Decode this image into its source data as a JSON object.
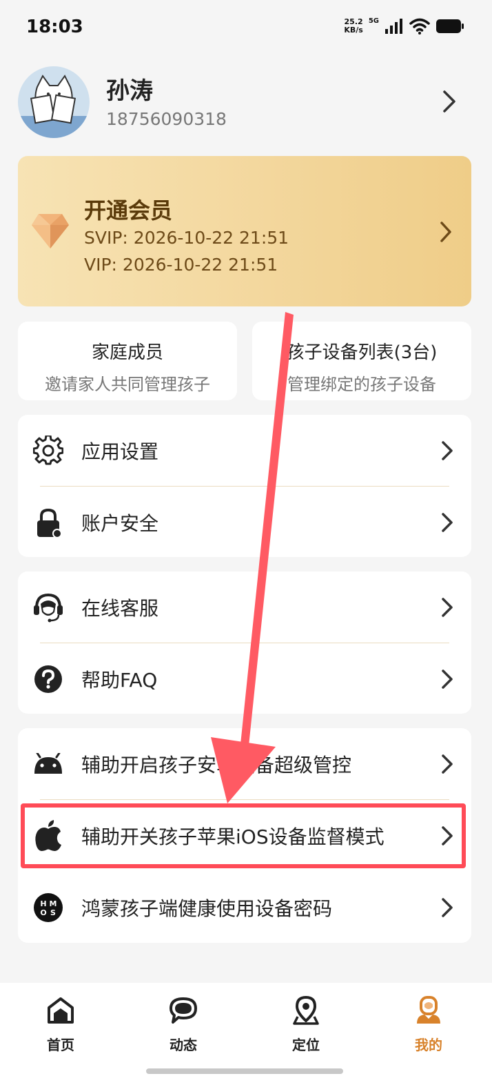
{
  "status_bar": {
    "time": "18:03",
    "net_speed_value": "25.2",
    "net_speed_unit": "KB/s",
    "network_type": "5G",
    "icons": [
      "signal-icon",
      "wifi-icon",
      "battery-icon"
    ]
  },
  "profile": {
    "name": "孙涛",
    "phone": "18756090318"
  },
  "vip": {
    "title": "开通会员",
    "svip": "SVIP: 2026-10-22 21:51",
    "vip": "VIP: 2026-10-22 21:51"
  },
  "quick_cards": [
    {
      "title": "家庭成员",
      "subtitle": "邀请家人共同管理孩子"
    },
    {
      "title": "孩子设备列表(3台)",
      "subtitle": "管理绑定的孩子设备"
    }
  ],
  "menu": {
    "settings": "应用设置",
    "security": "账户安全",
    "support": "在线客服",
    "faq": "帮助FAQ",
    "android": "辅助开启孩子安卓设备超级管控",
    "ios": "辅助开关孩子苹果iOS设备监督模式",
    "harmony": "鸿蒙孩子端健康使用设备密码"
  },
  "bottom_nav": [
    {
      "label": "首页",
      "icon": "home-icon"
    },
    {
      "label": "动态",
      "icon": "chat-bubble-icon"
    },
    {
      "label": "定位",
      "icon": "location-pin-icon"
    },
    {
      "label": "我的",
      "icon": "person-icon",
      "active": true
    }
  ],
  "colors": {
    "accent": "#d8822b",
    "highlight_border": "#ff4b57",
    "annotation_arrow": "#ff5a63",
    "vip_gold": "#f3d79d"
  }
}
